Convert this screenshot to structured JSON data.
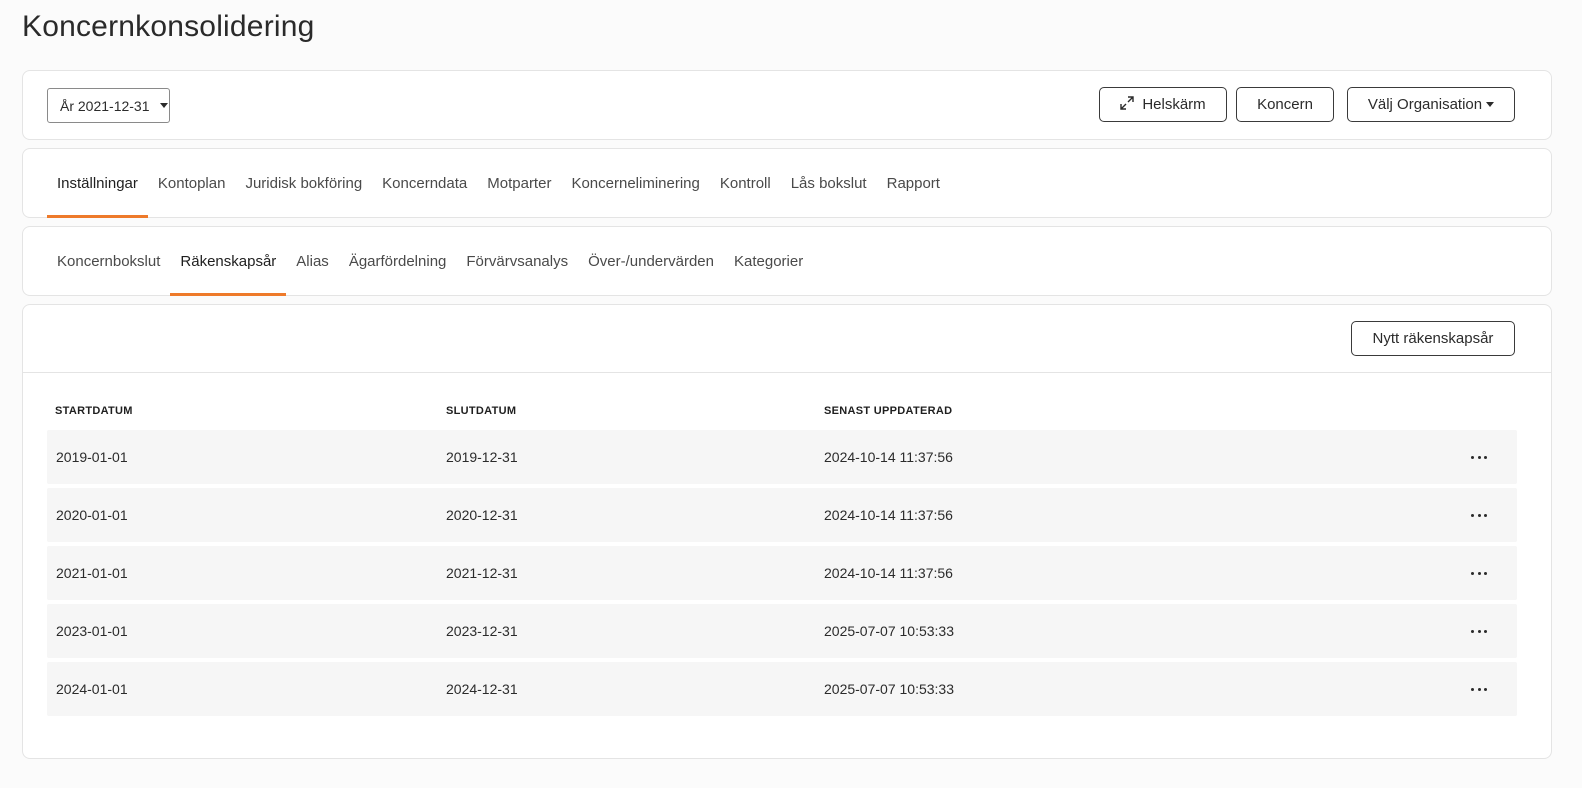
{
  "page": {
    "title": "Koncernkonsolidering"
  },
  "toolbar": {
    "year_select": "År 2021-12-31",
    "fullscreen_label": "Helskärm",
    "group_label": "Koncern",
    "select_org_label": "Välj Organisation"
  },
  "main_tabs": [
    {
      "label": "Inställningar",
      "active": true
    },
    {
      "label": "Kontoplan",
      "active": false
    },
    {
      "label": "Juridisk bokföring",
      "active": false
    },
    {
      "label": "Koncerndata",
      "active": false
    },
    {
      "label": "Motparter",
      "active": false
    },
    {
      "label": "Koncerneliminering",
      "active": false
    },
    {
      "label": "Kontroll",
      "active": false
    },
    {
      "label": "Lås bokslut",
      "active": false
    },
    {
      "label": "Rapport",
      "active": false
    }
  ],
  "sub_tabs": [
    {
      "label": "Koncernbokslut",
      "active": false
    },
    {
      "label": "Räkenskapsår",
      "active": true
    },
    {
      "label": "Alias",
      "active": false
    },
    {
      "label": "Ägarfördelning",
      "active": false
    },
    {
      "label": "Förvärvsanalys",
      "active": false
    },
    {
      "label": "Över-/undervärden",
      "active": false
    },
    {
      "label": "Kategorier",
      "active": false
    }
  ],
  "table": {
    "new_button_label": "Nytt räkenskapsår",
    "headers": {
      "start": "STARTDATUM",
      "end": "SLUTDATUM",
      "updated": "SENAST UPPDATERAD"
    },
    "rows": [
      {
        "start": "2019-01-01",
        "end": "2019-12-31",
        "updated": "2024-10-14 11:37:56"
      },
      {
        "start": "2020-01-01",
        "end": "2020-12-31",
        "updated": "2024-10-14 11:37:56"
      },
      {
        "start": "2021-01-01",
        "end": "2021-12-31",
        "updated": "2024-10-14 11:37:56"
      },
      {
        "start": "2023-01-01",
        "end": "2023-12-31",
        "updated": "2025-07-07 10:53:33"
      },
      {
        "start": "2024-01-01",
        "end": "2024-12-31",
        "updated": "2025-07-07 10:53:33"
      }
    ]
  },
  "colors": {
    "accent": "#ee7a2a",
    "row_bg": "#f6f6f6"
  },
  "icons": {
    "fullscreen": "expand-arrows-icon",
    "row_menu": "more-horizontal-icon"
  }
}
